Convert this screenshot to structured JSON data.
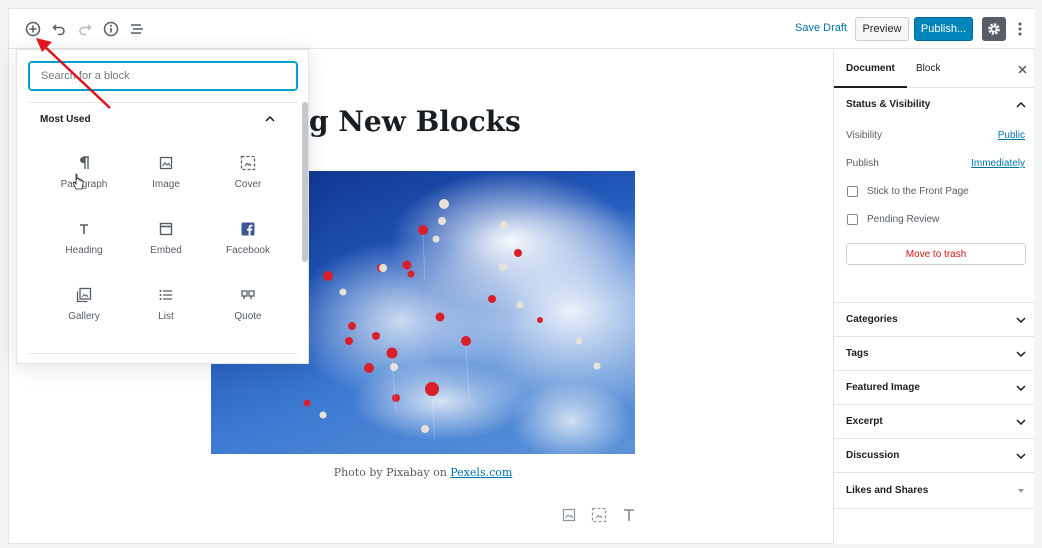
{
  "toolbar": {
    "save_draft": "Save Draft",
    "preview": "Preview",
    "publish": "Publish..."
  },
  "post": {
    "title": "g New Blocks",
    "caption_prefix": "Photo by Pixabay on ",
    "caption_link": "Pexels.com"
  },
  "inserter": {
    "search_placeholder": "Search for a block",
    "panel_title": "Most Used",
    "blocks": [
      {
        "label": "Paragraph",
        "icon": "paragraph-icon"
      },
      {
        "label": "Image",
        "icon": "image-icon"
      },
      {
        "label": "Cover",
        "icon": "cover-icon"
      },
      {
        "label": "Heading",
        "icon": "heading-icon"
      },
      {
        "label": "Embed",
        "icon": "embed-icon"
      },
      {
        "label": "Facebook",
        "icon": "facebook-icon"
      },
      {
        "label": "Gallery",
        "icon": "gallery-icon"
      },
      {
        "label": "List",
        "icon": "list-icon"
      },
      {
        "label": "Quote",
        "icon": "quote-icon"
      }
    ]
  },
  "sidebar": {
    "tab_document": "Document",
    "tab_block": "Block",
    "status_title": "Status & Visibility",
    "visibility_label": "Visibility",
    "visibility_value": "Public",
    "publish_label": "Publish",
    "publish_value": "Immediately",
    "stick_label": "Stick to the Front Page",
    "pending_label": "Pending Review",
    "trash_label": "Move to trash",
    "sections": [
      "Categories",
      "Tags",
      "Featured Image",
      "Excerpt",
      "Discussion",
      "Likes and Shares"
    ]
  },
  "colors": {
    "accent": "#0085ba",
    "link": "#0073aa",
    "danger": "#cc1818",
    "annotation_arrow": "#e0121b"
  }
}
